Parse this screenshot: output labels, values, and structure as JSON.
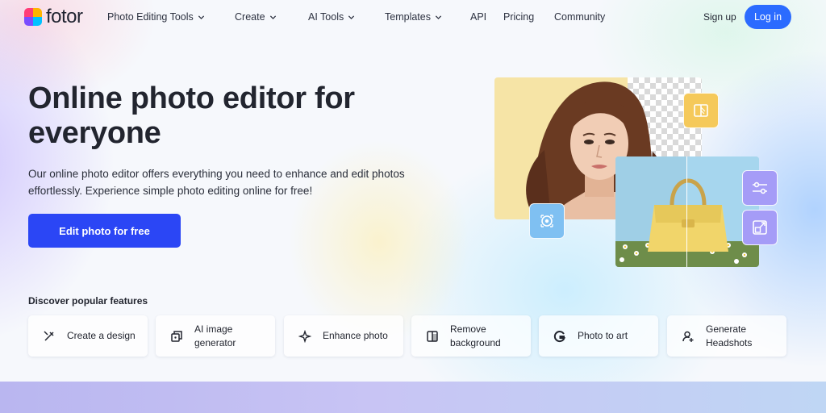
{
  "brand": {
    "name": "fotor",
    "colors": [
      "#ff3d77",
      "#ffb400",
      "#7a4dff",
      "#00c2ff"
    ]
  },
  "nav": {
    "items": [
      {
        "label": "Photo Editing Tools",
        "has_dropdown": true
      },
      {
        "label": "Create",
        "has_dropdown": true
      },
      {
        "label": "AI Tools",
        "has_dropdown": true
      },
      {
        "label": "Templates",
        "has_dropdown": true
      },
      {
        "label": "API",
        "has_dropdown": false
      },
      {
        "label": "Pricing",
        "has_dropdown": false
      },
      {
        "label": "Community",
        "has_dropdown": false
      }
    ],
    "signup_label": "Sign up",
    "login_label": "Log in",
    "accent": "#2b6bff"
  },
  "hero": {
    "title": "Online photo editor for everyone",
    "description": "Our online photo editor offers everything you need to enhance and edit photos effortlessly. Experience simple photo editing online for free!",
    "cta_label": "Edit photo for free",
    "cta_color": "#2b46f5",
    "illustration_icons": [
      "background-remove-icon",
      "ai-enhance-icon",
      "adjust-sliders-icon",
      "resize-icon"
    ]
  },
  "features": {
    "title": "Discover popular features",
    "items": [
      {
        "label": "Create a design",
        "icon": "design-pen-icon"
      },
      {
        "label": "AI image generator",
        "icon": "ai-image-icon"
      },
      {
        "label": "Enhance photo",
        "icon": "sparkle-enhance-icon"
      },
      {
        "label": "Remove background",
        "icon": "remove-bg-icon"
      },
      {
        "label": "Photo to art",
        "icon": "photo-art-icon"
      },
      {
        "label": "Generate Headshots",
        "icon": "headshot-icon"
      }
    ]
  }
}
